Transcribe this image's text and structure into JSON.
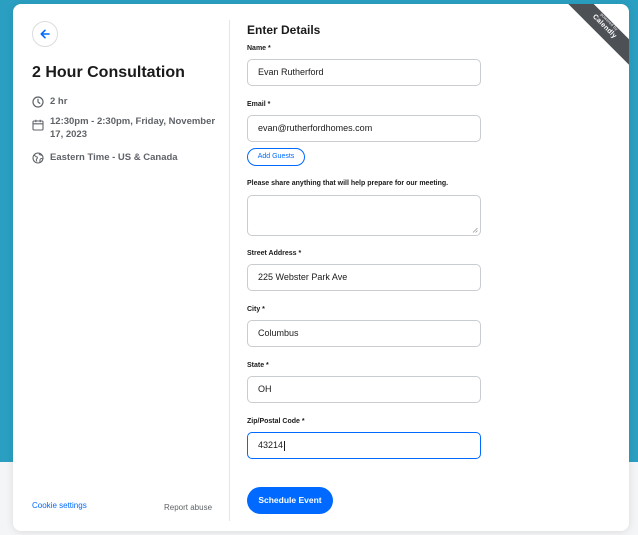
{
  "brand": {
    "ribbon_top": "powered by",
    "ribbon_name": "Calendly"
  },
  "event": {
    "title": "2 Hour Consultation",
    "duration": "2 hr",
    "time_line1": "12:30pm - 2:30pm, Friday, November",
    "time_line2": "17, 2023",
    "timezone": "Eastern Time - US & Canada"
  },
  "footer": {
    "cookie_label": "Cookie settings",
    "report_label": "Report abuse"
  },
  "form": {
    "title": "Enter Details",
    "name_label": "Name *",
    "name_value": "Evan Rutherford",
    "email_label": "Email *",
    "email_value": "evan@rutherfordhomes.com",
    "add_guests_label": "Add Guests",
    "notes_label": "Please share anything that will help prepare for our meeting.",
    "notes_value": "",
    "street_label": "Street Address *",
    "street_value": "225 Webster Park Ave",
    "city_label": "City *",
    "city_value": "Columbus",
    "state_label": "State *",
    "state_value": "OH",
    "zip_label": "Zip/Postal Code *",
    "zip_value": "43214",
    "submit_label": "Schedule Event"
  },
  "colors": {
    "accent": "#0069ff",
    "page_bg": "#2a9fc1",
    "ribbon": "#4d5055"
  },
  "icons": [
    "back-arrow-icon",
    "clock-icon",
    "calendar-icon",
    "globe-icon"
  ]
}
